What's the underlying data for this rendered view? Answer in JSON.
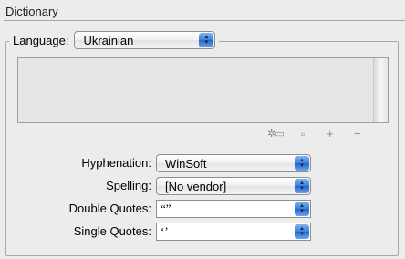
{
  "section": {
    "title": "Dictionary"
  },
  "language": {
    "label": "Language:",
    "value": "Ukrainian"
  },
  "dictionary_list": {
    "items": []
  },
  "toolbar": {
    "icons": [
      "new-dictionary-icon",
      "page-icon",
      "add-icon",
      "remove-icon"
    ]
  },
  "hyphenation": {
    "label": "Hyphenation:",
    "value": "WinSoft"
  },
  "spelling": {
    "label": "Spelling:",
    "value": "[No vendor]"
  },
  "double_quotes": {
    "label": "Double Quotes:",
    "value": "“”"
  },
  "single_quotes": {
    "label": "Single Quotes:",
    "value": "‘’"
  }
}
